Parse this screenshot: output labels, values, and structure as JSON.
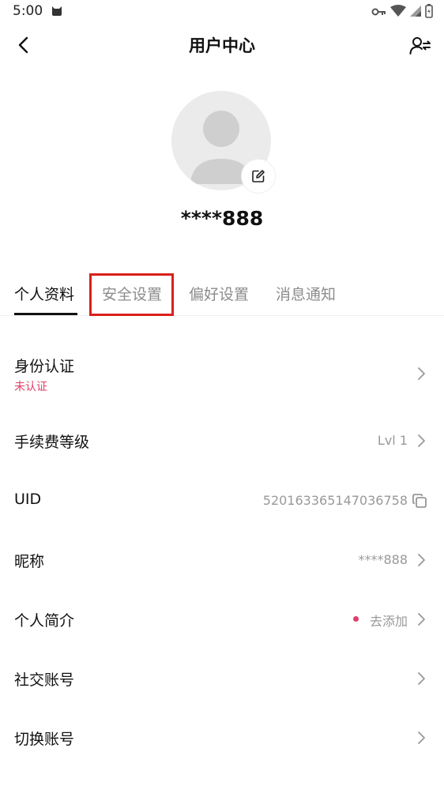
{
  "status_bar": {
    "time": "5:00"
  },
  "nav": {
    "title": "用户中心"
  },
  "profile": {
    "username": "****888"
  },
  "tabs": [
    {
      "label": "个人资料",
      "active": true
    },
    {
      "label": "安全设置",
      "active": false
    },
    {
      "label": "偏好设置",
      "active": false
    },
    {
      "label": "消息通知",
      "active": false
    }
  ],
  "rows": {
    "identity": {
      "label": "身份认证",
      "sub": "未认证"
    },
    "fee_level": {
      "label": "手续费等级",
      "value": "Lvl 1"
    },
    "uid": {
      "label": "UID",
      "value": "520163365147036758"
    },
    "nickname": {
      "label": "昵称",
      "value": "****888"
    },
    "bio": {
      "label": "个人简介",
      "value": "去添加"
    },
    "social": {
      "label": "社交账号"
    },
    "switch_account": {
      "label": "切换账号"
    }
  },
  "colors": {
    "accent_pink": "#e0406b",
    "highlight_red": "#d9201c",
    "text_gray": "#999999"
  }
}
